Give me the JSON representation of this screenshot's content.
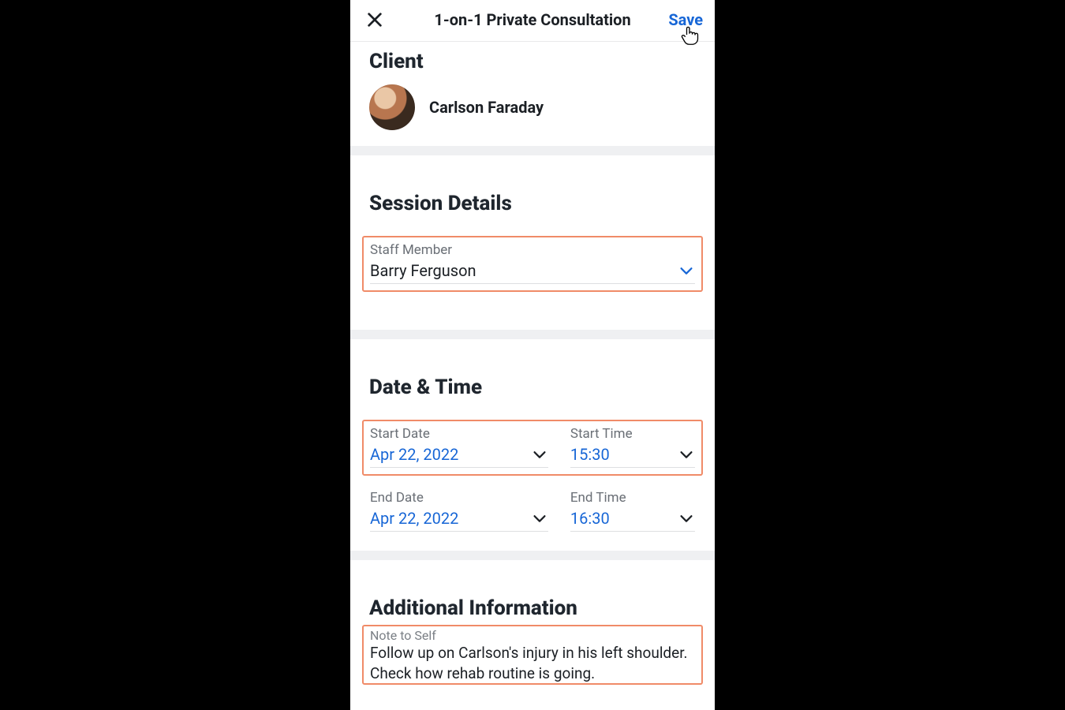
{
  "header": {
    "title": "1-on-1 Private Consultation",
    "save_label": "Save"
  },
  "client": {
    "section_title": "Client",
    "name": "Carlson Faraday"
  },
  "session": {
    "section_title": "Session Details",
    "staff_label": "Staff Member",
    "staff_value": "Barry Ferguson"
  },
  "datetime": {
    "section_title": "Date & Time",
    "start_date_label": "Start Date",
    "start_date_value": "Apr 22, 2022",
    "start_time_label": "Start Time",
    "start_time_value": "15:30",
    "end_date_label": "End Date",
    "end_date_value": "Apr 22, 2022",
    "end_time_label": "End Time",
    "end_time_value": "16:30"
  },
  "additional": {
    "section_title": "Additional Information",
    "note_label": "Note to Self",
    "note_text": "Follow up on Carlson's injury in his left shoulder. Check how rehab routine is going."
  }
}
